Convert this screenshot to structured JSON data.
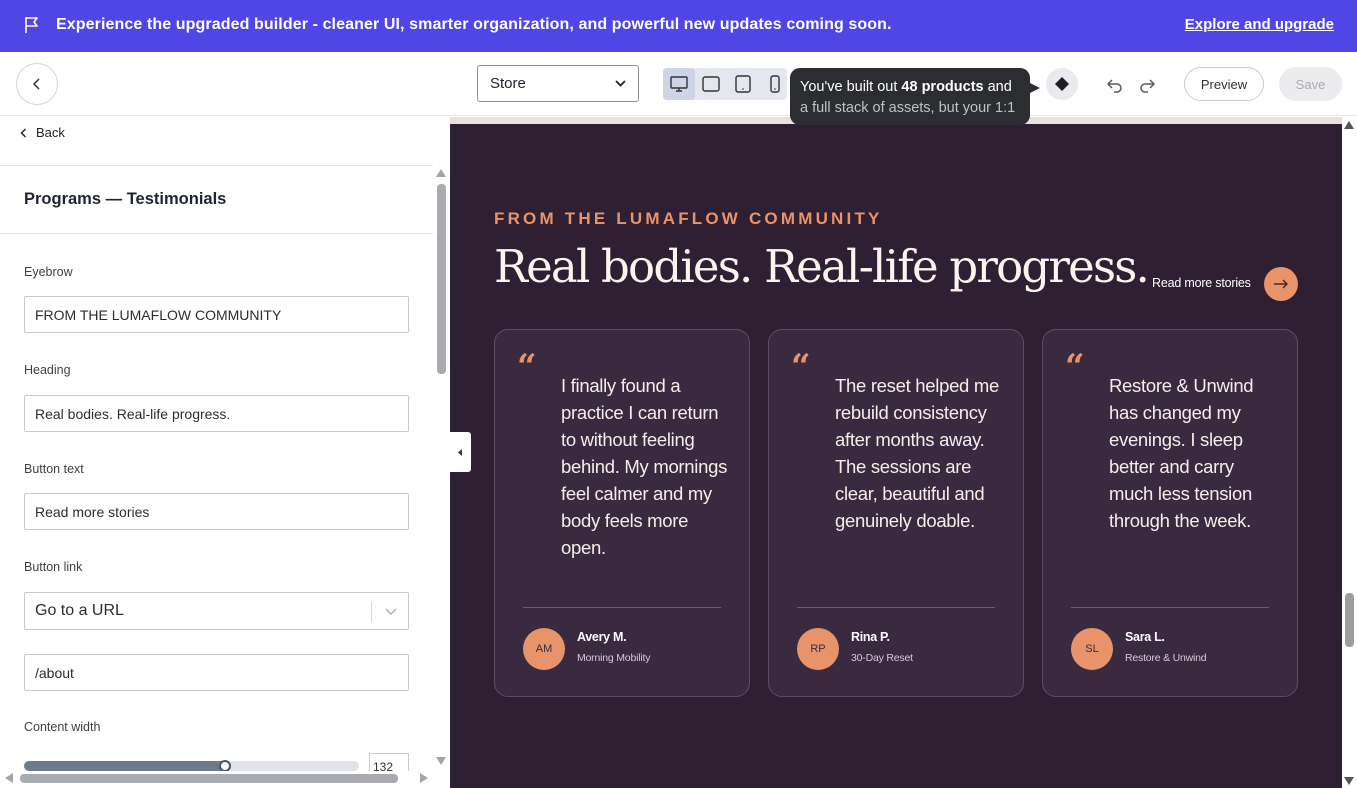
{
  "banner": {
    "message": "Experience the upgraded builder - cleaner UI, smarter organization, and powerful new updates coming soon.",
    "link": "Explore and upgrade"
  },
  "toolbar": {
    "store_select": "Store",
    "tooltip_pre": "You've built out ",
    "tooltip_bold": "48 products",
    "tooltip_post": " and",
    "tooltip_line2": "a full stack of assets, but your 1:1",
    "preview": "Preview",
    "save": "Save"
  },
  "left_panel": {
    "back": "Back",
    "title": "Programs — Testimonials",
    "fields": {
      "eyebrow_label": "Eyebrow",
      "eyebrow_value": "FROM THE LUMAFLOW COMMUNITY",
      "heading_label": "Heading",
      "heading_value": "Real bodies. Real-life progress.",
      "button_text_label": "Button text",
      "button_text_value": "Read more stories",
      "button_link_label": "Button link",
      "button_link_select": "Go to a URL",
      "button_link_url": "/about",
      "content_width_label": "Content width",
      "content_width_value": "132"
    },
    "content_width_fraction": 0.6
  },
  "preview": {
    "eyebrow": "FROM THE LUMAFLOW COMMUNITY",
    "heading": "Real bodies. Real-life progress.",
    "read_more": "Read more stories",
    "cards": [
      {
        "quote": "I finally found a practice I can return to without feeling behind. My mornings feel calmer and my body feels more open.",
        "initials": "AM",
        "name": "Avery M.",
        "program": "Morning Mobility"
      },
      {
        "quote": "The reset helped me rebuild consistency after months away. The sessions are clear, beautiful and genuinely doable.",
        "initials": "RP",
        "name": "Rina P.",
        "program": "30-Day Reset"
      },
      {
        "quote": "Restore & Unwind has changed my evenings. I sleep better and carry much less tension through the week.",
        "initials": "SL",
        "name": "Sara L.",
        "program": "Restore & Unwind"
      }
    ]
  },
  "colors": {
    "banner": "#4f46e5",
    "canvas_bg": "#2f1f33",
    "accent": "#e8936a"
  },
  "icons": [
    "flag-icon",
    "chevron-left-icon",
    "chevron-down-icon",
    "desktop-icon",
    "tablet-landscape-icon",
    "tablet-portrait-icon",
    "mobile-icon",
    "diamond-icon",
    "undo-icon",
    "redo-icon",
    "arrow-right-icon",
    "quote-icon"
  ]
}
